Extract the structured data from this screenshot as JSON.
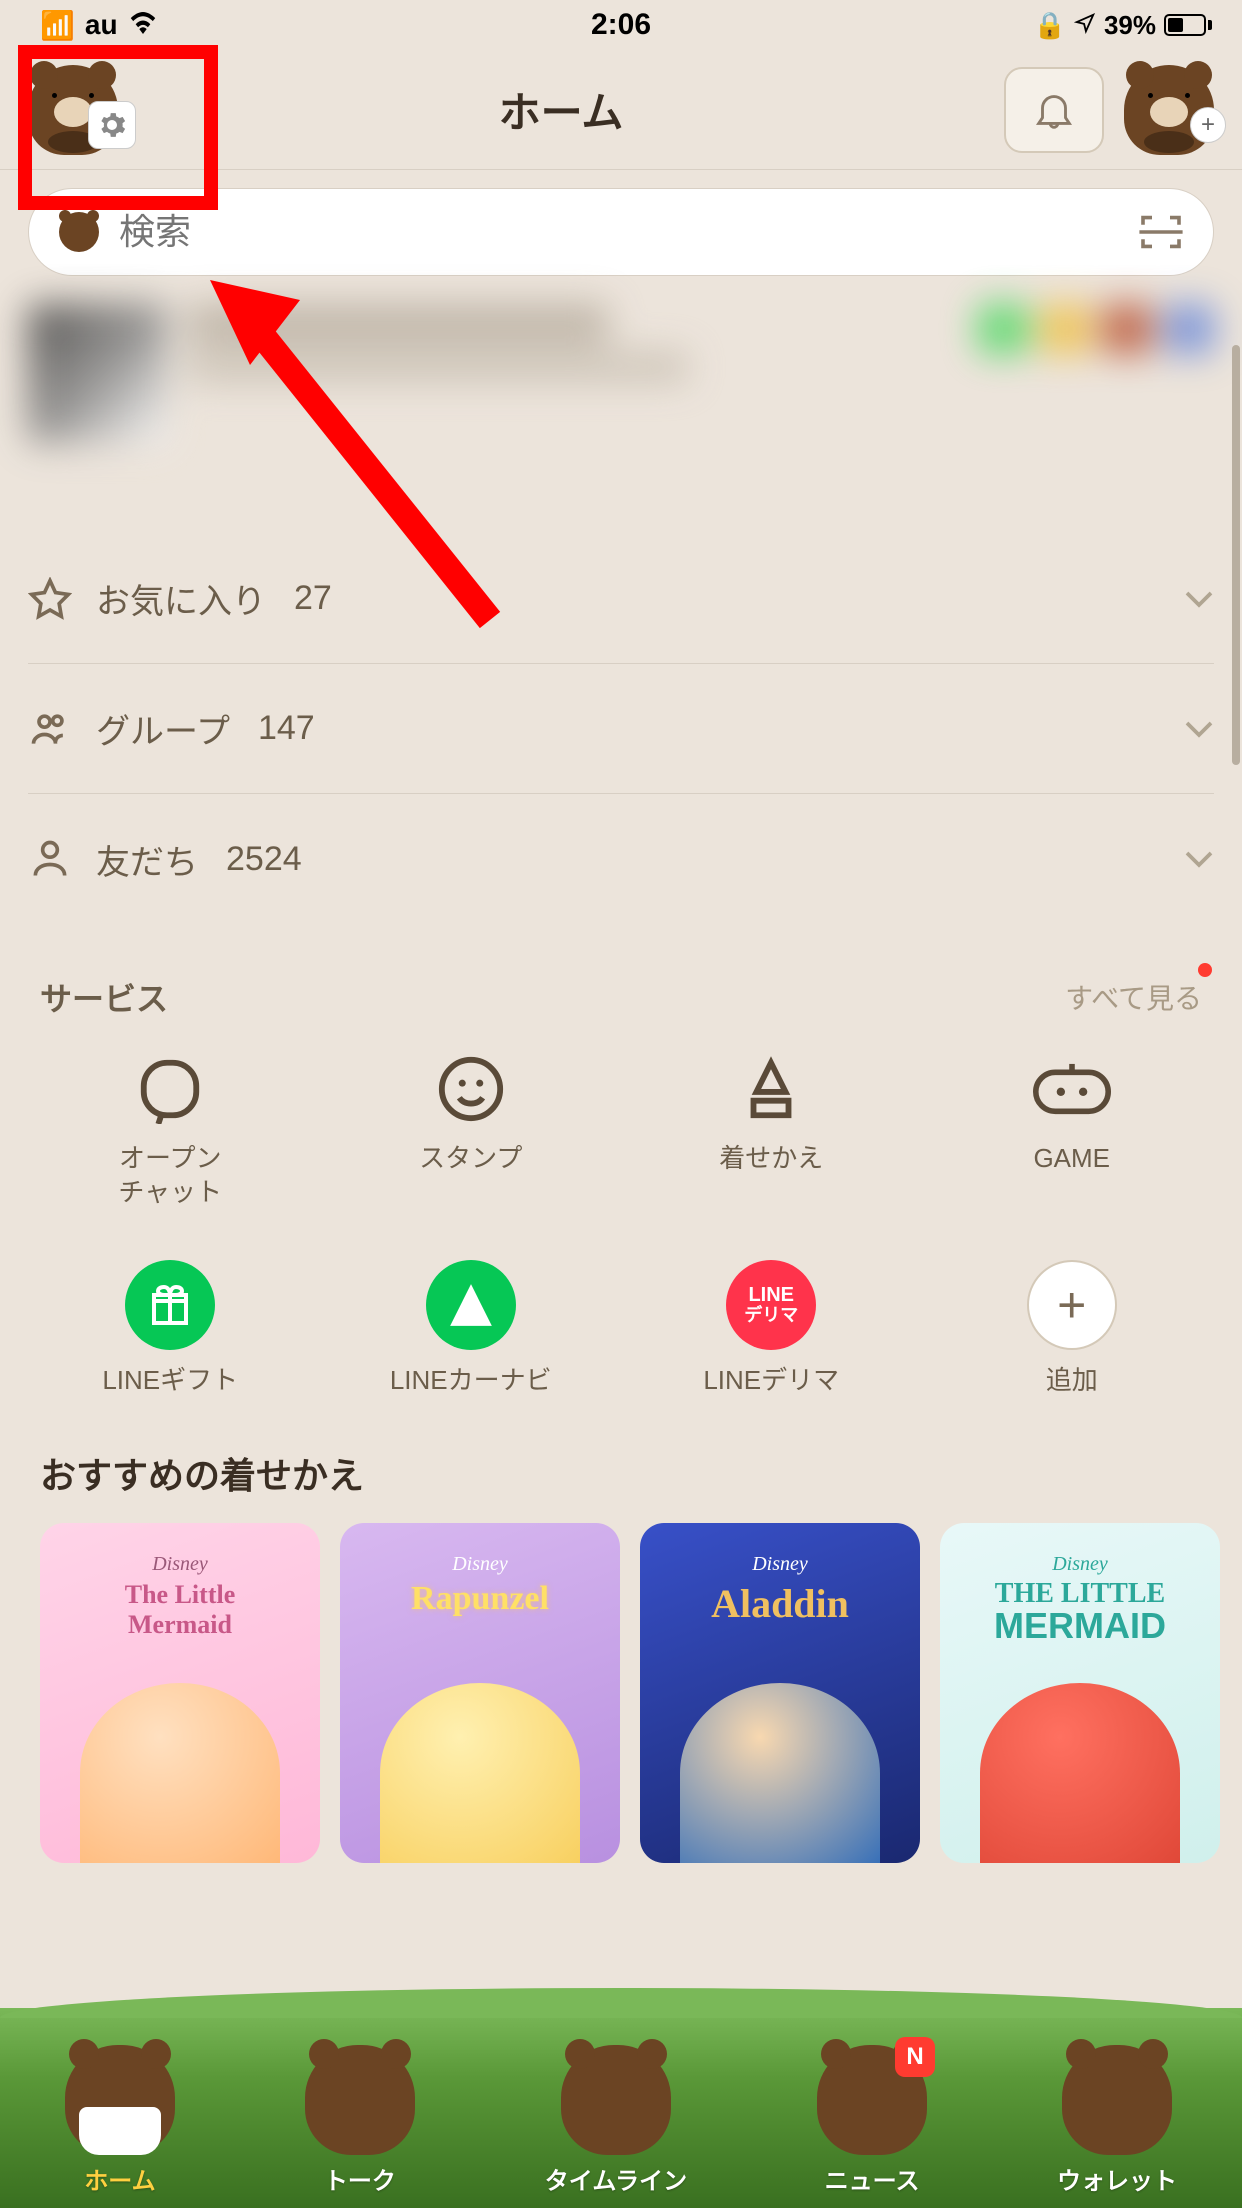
{
  "statusBar": {
    "carrier": "au",
    "time": "2:06",
    "battery": "39%"
  },
  "header": {
    "title": "ホーム"
  },
  "search": {
    "placeholder": "検索"
  },
  "listRows": [
    {
      "label": "お気に入り",
      "count": "27"
    },
    {
      "label": "グループ",
      "count": "147"
    },
    {
      "label": "友だち",
      "count": "2524"
    }
  ],
  "services": {
    "title": "サービス",
    "seeAll": "すべて見る",
    "items": [
      {
        "label": "オープン\nチャット"
      },
      {
        "label": "スタンプ"
      },
      {
        "label": "着せかえ"
      },
      {
        "label": "GAME"
      },
      {
        "label": "LINEギフト"
      },
      {
        "label": "LINEカーナビ"
      },
      {
        "label": "LINEデリマ"
      },
      {
        "label": "追加"
      }
    ],
    "deliveryText": {
      "line1": "LINE",
      "line2": "デリマ"
    }
  },
  "themes": {
    "title": "おすすめの着せかえ",
    "brand": "Disney",
    "cards": [
      {
        "title": "The Little Mermaid",
        "subtitle": ""
      },
      {
        "title": "Rapunzel"
      },
      {
        "title": "Aladdin"
      },
      {
        "title": "THE LITTLE MERMAID"
      }
    ]
  },
  "bottomNav": {
    "items": [
      {
        "label": "ホーム",
        "active": true
      },
      {
        "label": "トーク"
      },
      {
        "label": "タイムライン"
      },
      {
        "label": "ニュース",
        "badge": "N"
      },
      {
        "label": "ウォレット"
      }
    ]
  }
}
